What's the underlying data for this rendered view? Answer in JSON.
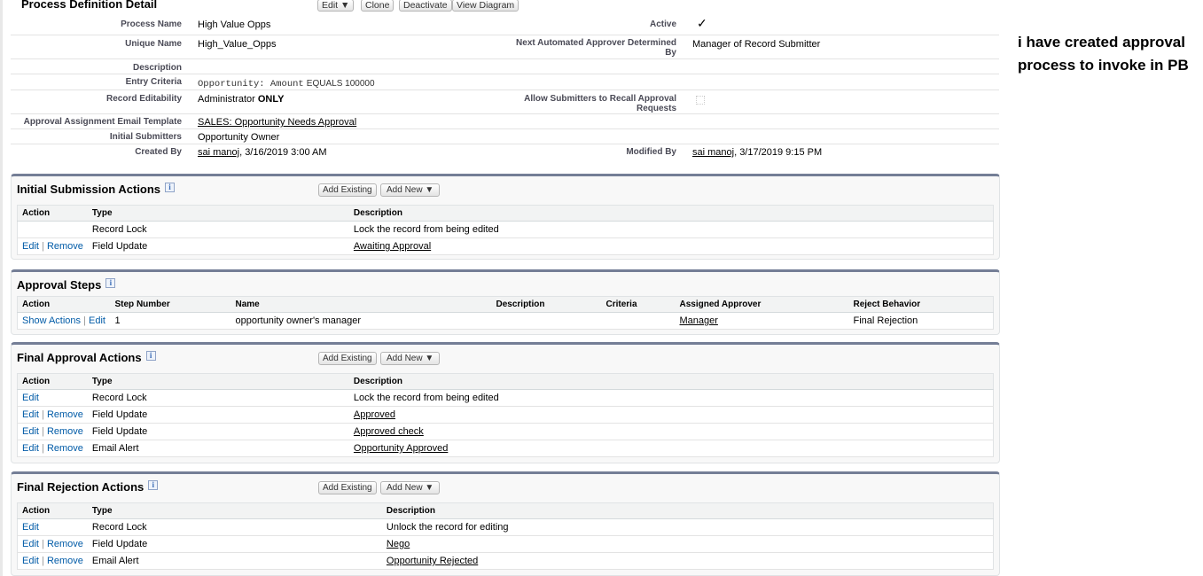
{
  "header": {
    "title": "Process Definition Detail",
    "buttons": [
      "Edit ▼",
      "Clone",
      "Deactivate",
      "View Diagram"
    ]
  },
  "detail": {
    "process_name_label": "Process Name",
    "process_name": "High Value Opps",
    "active_label": "Active",
    "active_mark": "✓",
    "unique_name_label": "Unique Name",
    "unique_name": "High_Value_Opps",
    "next_approver_label": "Next Automated Approver Determined By",
    "next_approver": "Manager of Record Submitter",
    "description_label": "Description",
    "entry_criteria_label": "Entry Criteria",
    "entry_criteria_field": "Opportunity: Amount",
    "entry_criteria_rest": "EQUALS 100000",
    "record_editability_label": "Record Editability",
    "record_editability": "Administrator",
    "record_editability_bold": "ONLY",
    "allow_recall_label": "Allow Submitters to Recall Approval Requests",
    "email_template_label": "Approval Assignment Email Template",
    "email_template": "SALES: Opportunity Needs Approval",
    "initial_submitters_label": "Initial Submitters",
    "initial_submitters": "Opportunity Owner",
    "created_by_label": "Created By",
    "created_by_user": "sai manoj",
    "created_by_date": ", 3/16/2019 3:00 AM",
    "modified_by_label": "Modified By",
    "modified_by_user": "sai manoj",
    "modified_by_date": ", 3/17/2019 9:15 PM"
  },
  "common": {
    "add_existing": "Add Existing",
    "add_new": "Add New ▼",
    "edit": "Edit",
    "remove": "Remove",
    "sep": "|",
    "show_actions": "Show Actions",
    "info": "i"
  },
  "sections": [
    {
      "id": "initial-submission",
      "title": "Initial Submission Actions",
      "buttons": true,
      "columns": [
        "Action",
        "Type",
        "Description"
      ],
      "rows": [
        {
          "actions": [],
          "cells": [
            "Record Lock",
            "Lock the record from being edited"
          ],
          "link": false
        },
        {
          "actions": [
            "edit",
            "remove"
          ],
          "cells": [
            "Field Update",
            "Awaiting Approval"
          ],
          "link": true
        }
      ]
    },
    {
      "id": "approval-steps",
      "title": "Approval Steps",
      "buttons": false,
      "columns": [
        "Action",
        "Step Number",
        "Name",
        "Description",
        "Criteria",
        "Assigned Approver",
        "Reject Behavior"
      ],
      "rows": [
        {
          "actions": [
            "show_actions",
            "edit"
          ],
          "cells": [
            "1",
            "opportunity owner's manager",
            "",
            "",
            "Manager",
            "Final Rejection"
          ],
          "linkcol": 4
        }
      ]
    },
    {
      "id": "final-approval",
      "title": "Final Approval Actions",
      "buttons": true,
      "columns": [
        "Action",
        "Type",
        "Description"
      ],
      "rows": [
        {
          "actions": [
            "edit"
          ],
          "cells": [
            "Record Lock",
            "Lock the record from being edited"
          ],
          "link": false
        },
        {
          "actions": [
            "edit",
            "remove"
          ],
          "cells": [
            "Field Update",
            "Approved"
          ],
          "link": true
        },
        {
          "actions": [
            "edit",
            "remove"
          ],
          "cells": [
            "Field Update",
            "Approved check"
          ],
          "link": true
        },
        {
          "actions": [
            "edit",
            "remove"
          ],
          "cells": [
            "Email Alert",
            "Opportunity Approved"
          ],
          "link": true
        }
      ]
    },
    {
      "id": "final-rejection",
      "title": "Final Rejection Actions",
      "buttons": true,
      "columns": [
        "Action",
        "Type",
        "Description"
      ],
      "rows": [
        {
          "actions": [
            "edit"
          ],
          "cells": [
            "Record Lock",
            "Unlock the record for editing"
          ],
          "link": false
        },
        {
          "actions": [
            "edit",
            "remove"
          ],
          "cells": [
            "Field Update",
            "Nego"
          ],
          "link": true
        },
        {
          "actions": [
            "edit",
            "remove"
          ],
          "cells": [
            "Email Alert",
            "Opportunity Rejected"
          ],
          "link": true
        }
      ]
    }
  ],
  "note": "i have created approval process to invoke in PB"
}
